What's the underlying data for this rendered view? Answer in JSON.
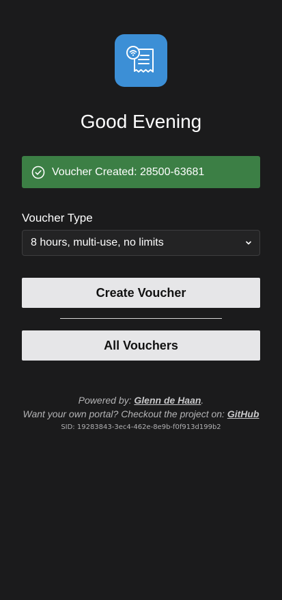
{
  "app": {
    "icon": "receipt-wifi-icon",
    "icon_color": "#3c8fd6"
  },
  "greeting": "Good Evening",
  "alert": {
    "icon": "check-circle-icon",
    "text": "Voucher Created: 28500-63681",
    "color": "#3c7f45"
  },
  "form": {
    "voucher_type_label": "Voucher Type",
    "voucher_type_selected": "8 hours, multi-use, no limits"
  },
  "buttons": {
    "create": "Create Voucher",
    "all": "All Vouchers"
  },
  "footer": {
    "powered_prefix": "Powered by: ",
    "author": "Glenn de Haan",
    "powered_suffix": ".",
    "portal_prefix": "Want your own portal? Checkout the project on: ",
    "github": "GitHub",
    "sid": "SID: 19283843-3ec4-462e-8e9b-f0f913d199b2"
  }
}
